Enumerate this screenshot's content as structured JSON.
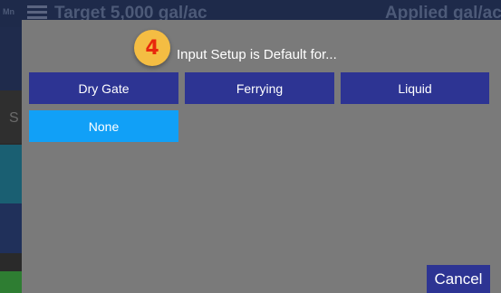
{
  "background": {
    "header_left": "Target 5,000 gal/ac",
    "header_right": "Applied gal/ac",
    "side_letter": "S",
    "mini_label": "Mn"
  },
  "dialog": {
    "step_number": "4",
    "title": "Input Setup is Default for...",
    "options": [
      {
        "label": "Dry Gate",
        "state": "normal"
      },
      {
        "label": "Ferrying",
        "state": "normal"
      },
      {
        "label": "Liquid",
        "state": "normal"
      },
      {
        "label": "None",
        "state": "selected"
      }
    ],
    "cancel_label": "Cancel"
  },
  "colors": {
    "option_bg": "#2d3493",
    "selected_bg": "#11a0f7",
    "badge_bg": "#f4bd43",
    "badge_text": "#e8280c",
    "dialog_bg": "#7a7a7a"
  }
}
